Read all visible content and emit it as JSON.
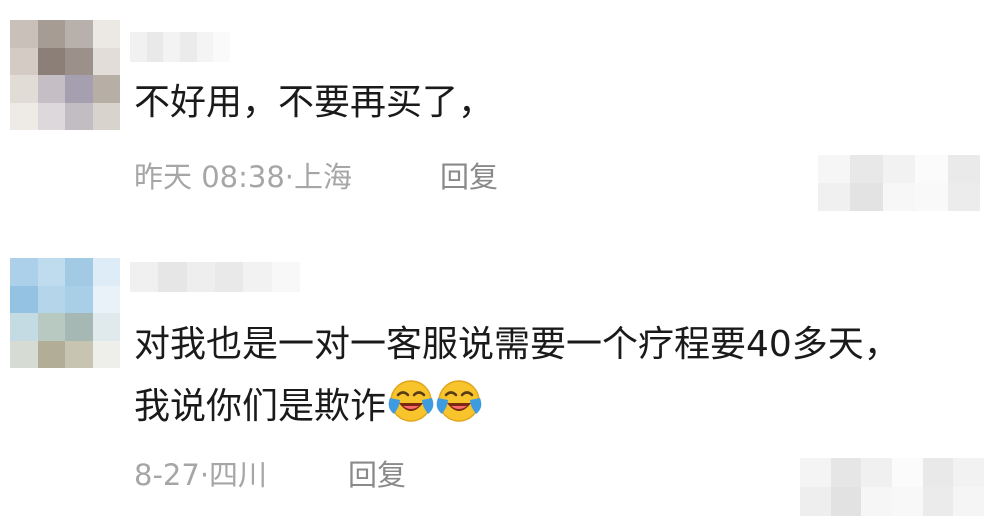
{
  "comments": [
    {
      "text_lines": [
        "不好用，不要再买了，"
      ],
      "time": "昨天 08:38·",
      "location": "上海",
      "reply_label": "回复"
    },
    {
      "text_lines": [
        "对我也是一对一客服说需要一个疗程要40多天，",
        "我说你们是欺诈"
      ],
      "emojis": [
        "laughing-crying-emoji",
        "laughing-crying-emoji"
      ],
      "time": "8-27·",
      "location": "四川",
      "reply_label": "回复"
    }
  ],
  "colors": {
    "text": "#1a1a1a",
    "meta": "#a6a6a6",
    "reply": "#8a8a8a",
    "emoji_face": "#f7c42c",
    "emoji_tear": "#3f9be0"
  }
}
